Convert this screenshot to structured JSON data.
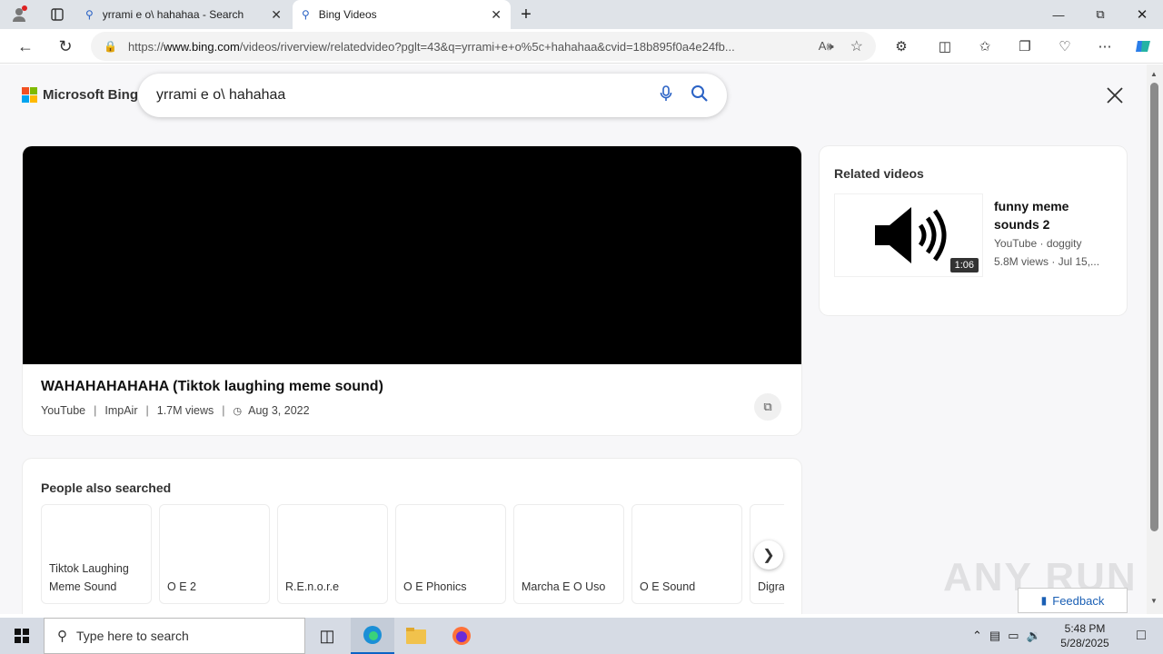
{
  "browser": {
    "tabs": [
      {
        "label": "yrrami e o\\ hahahaa - Search",
        "icon": "search-icon"
      },
      {
        "label": "Bing Videos",
        "icon": "search-icon"
      }
    ],
    "url_prefix": "https://",
    "url_domain": "www.bing.com",
    "url_rest": "/videos/riverview/relatedvideo?pglt=43&q=yrrami+e+o%5c+hahahaa&cvid=18b895f0a4e24fb..."
  },
  "bing": {
    "logo_text": "Microsoft Bing",
    "search_query": "yrrami e o\\ hahahaa"
  },
  "video": {
    "title": "WAHAHAHAHAHA (Tiktok laughing meme sound)",
    "source": "YouTube",
    "channel": "ImpAir",
    "views": "1.7M views",
    "date": "Aug 3, 2022",
    "separator": "|"
  },
  "related": {
    "heading": "Related videos",
    "items": [
      {
        "title": "funny meme sounds 2",
        "source_line": "YouTube · doggity",
        "views_line": "5.8M views · Jul 15,...",
        "duration": "1:06"
      }
    ]
  },
  "people_also_searched": {
    "heading": "People also searched",
    "items": [
      "Tiktok Laughing Meme Sound",
      "O E 2",
      "R.E.n.o.r.e",
      "O E Phonics",
      "Marcha E O Uso",
      "O E Sound",
      "Digra"
    ]
  },
  "feedback_label": "Feedback",
  "watermark": "ANY RUN",
  "taskbar": {
    "search_placeholder": "Type here to search",
    "time": "5:48 PM",
    "date": "5/28/2025"
  }
}
